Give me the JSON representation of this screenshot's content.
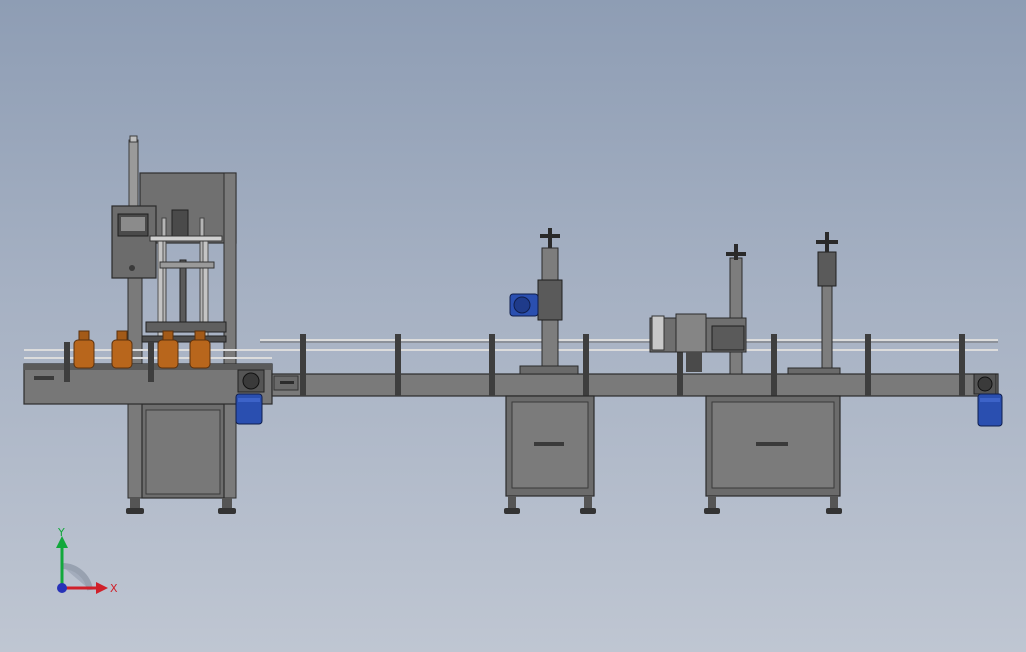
{
  "viewport": {
    "background_top": "#8e9db4",
    "background_bottom": "#bfc6d2",
    "model": "bottle-filling-capping-labeling-line"
  },
  "triad": {
    "x_label": "X",
    "y_label": "Y",
    "x_color": "#d0202a",
    "y_color": "#12a83c",
    "z_color": "#2732b8"
  },
  "colors": {
    "frame": "#6f6f6f",
    "frame_dark": "#3c3c3c",
    "frame_light": "#8a8a8a",
    "motor": "#2a4fb0",
    "bottle": "#b8661c",
    "rail": "#d9d9d9"
  }
}
